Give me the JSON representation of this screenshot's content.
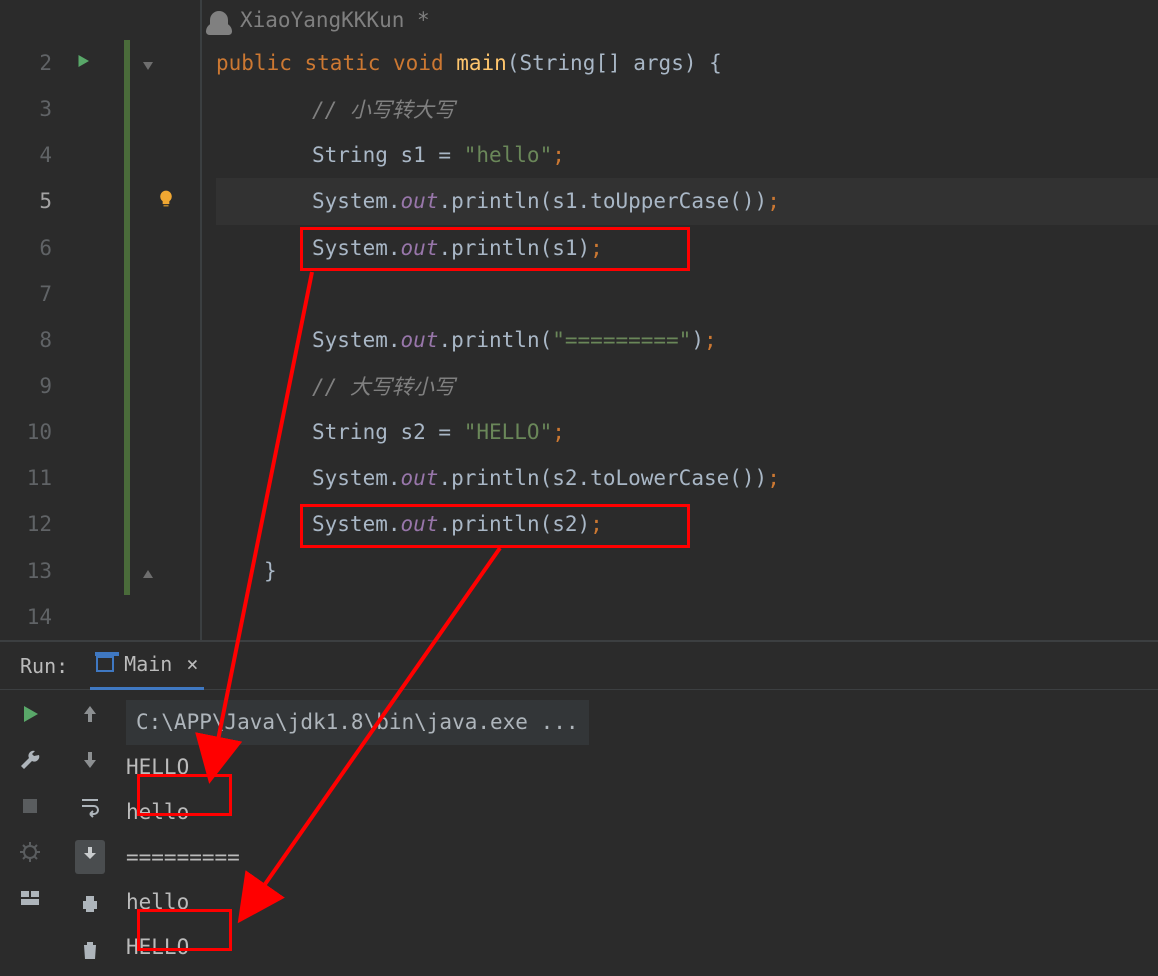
{
  "author": "XiaoYangKKKun *",
  "lines": [
    "2",
    "3",
    "4",
    "5",
    "6",
    "7",
    "8",
    "9",
    "10",
    "11",
    "12",
    "13",
    "14"
  ],
  "code": {
    "l2": {
      "kw1": "public ",
      "kw2": "static ",
      "kw3": "void ",
      "fn": "main",
      "open": "(",
      "ty": "String",
      "arr": "[] args",
      "cp": ") {"
    },
    "l3": "// 小写转大写",
    "l4": {
      "a": "String s1 = ",
      "s": "\"hello\"",
      "e": ";"
    },
    "l5": {
      "a": "System.",
      "b": "out",
      "c": ".println(s1.toUpperCase())",
      "e": ";"
    },
    "l6": {
      "a": "System.",
      "b": "out",
      "c": ".println(s1)",
      "e": ";"
    },
    "l8": {
      "a": "System.",
      "b": "out",
      "c": ".println(",
      "s": "\"=========\"",
      "d": ")",
      "e": ";"
    },
    "l9": "// 大写转小写",
    "l10": {
      "a": "String s2 = ",
      "s": "\"HELLO\"",
      "e": ";"
    },
    "l11": {
      "a": "System.",
      "b": "out",
      "c": ".println(s2.toLowerCase())",
      "e": ";"
    },
    "l12": {
      "a": "System.",
      "b": "out",
      "c": ".println(s2)",
      "e": ";"
    },
    "l13": "}"
  },
  "run": {
    "label": "Run:",
    "tab": "Main",
    "cmd": "C:\\APP\\Java\\jdk1.8\\bin\\java.exe ...",
    "out": [
      "HELLO",
      "hello",
      "=========",
      "hello",
      "HELLO"
    ]
  }
}
